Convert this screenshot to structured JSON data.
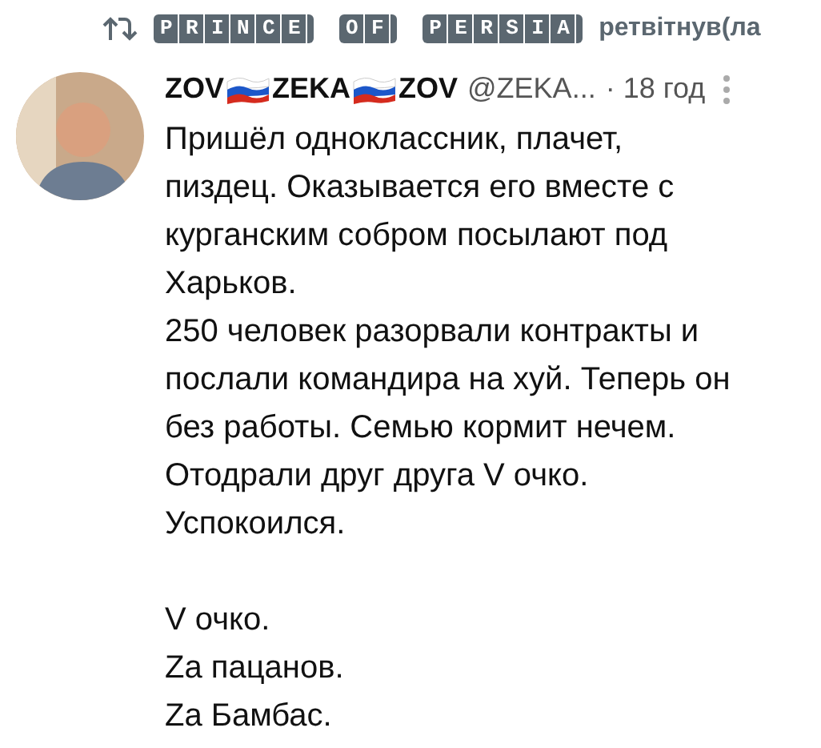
{
  "retweet": {
    "name": "PRINCE OF PERSIA",
    "action": "ретвітнув(ла"
  },
  "tweet": {
    "author": {
      "name_parts": [
        "ZOV",
        "ZEKA",
        "ZOV"
      ],
      "handle": "@ZEKA...",
      "time": "· 18 год"
    },
    "paragraphs": [
      "Пришёл одноклассник, плачет,\nпиздец. Оказывается его вместе с\nкурганским собром посылают под\nХарьков.\n250 человек разорвали контракты и\nпослали командира на хуй. Теперь он\nбез работы. Семью кормит нечем.\nОтодрали друг друга V очко.\nУспокоился.",
      "V очко.\nZa пацанов.\nZa Бамбас."
    ]
  }
}
